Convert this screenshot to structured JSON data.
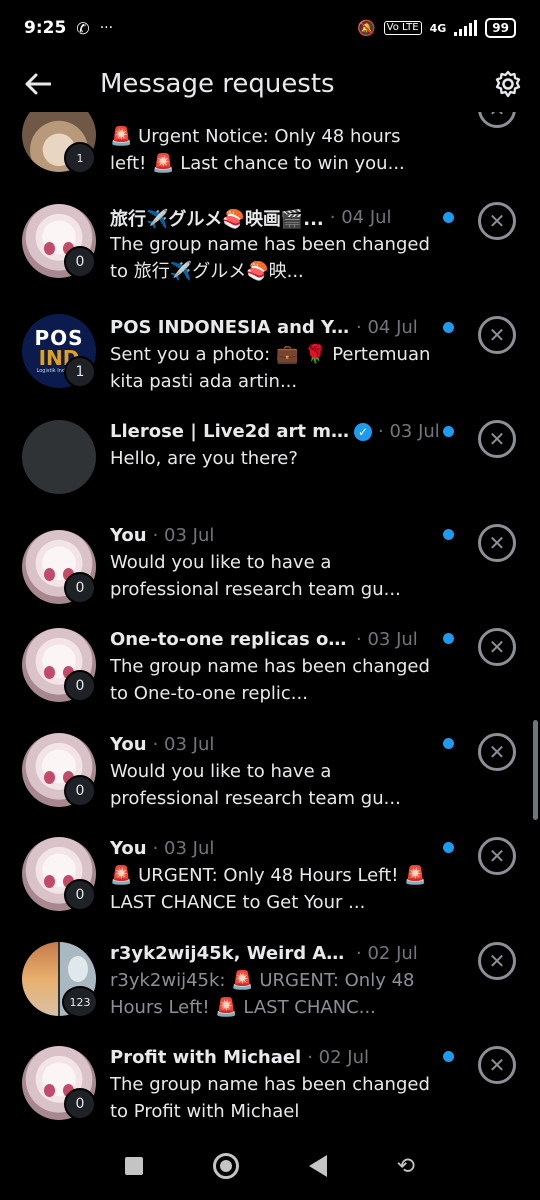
{
  "status": {
    "time": "9:25",
    "whatsapp_icon": "whatsapp-icon",
    "more": "···",
    "network": "4G",
    "volte": "Vo LTE",
    "battery": "99"
  },
  "header": {
    "title": "Message requests"
  },
  "rows": [
    {
      "name": "",
      "date": "",
      "preview": "🚨 Urgent Notice: Only 48 hours left! 🚨 Last chance to win you...",
      "badge": "1",
      "avatar": "hat",
      "unread": false
    },
    {
      "name": "旅行✈️グルメ🍣映画🎬...",
      "date": "· 04 Jul",
      "preview": "The group name has been changed to 旅行✈️グルメ🍣映...",
      "badge": "0",
      "avatar": "anime",
      "unread": true
    },
    {
      "name": "POS INDONESIA and Y...",
      "date": "· 04 Jul",
      "preview": "Sent you a photo: 💼 🌹 Pertemuan kita pasti ada artin...",
      "badge": "1",
      "avatar": "pos",
      "unread": true
    },
    {
      "name": "Llerose | Live2d art m...",
      "date": "· 03 Jul",
      "preview": "Hello, are you there?",
      "badge": "",
      "avatar": "gray",
      "unread": true,
      "verified": true
    },
    {
      "name": "You",
      "date": "· 03 Jul",
      "preview": "Would you like to have a professional research team gu...",
      "badge": "0",
      "avatar": "anime",
      "unread": true
    },
    {
      "name": "One-to-one replicas of...",
      "date": "· 03 Jul",
      "preview": "The group name has been changed to One-to-one replic...",
      "badge": "0",
      "avatar": "anime",
      "unread": true
    },
    {
      "name": "You",
      "date": "· 03 Jul",
      "preview": "Would you like to have a professional research team gu...",
      "badge": "0",
      "avatar": "anime",
      "unread": true
    },
    {
      "name": "You",
      "date": "· 03 Jul",
      "preview": "🚨 URGENT: Only 48 Hours Left! 🚨 LAST CHANCE to Get Your ...",
      "badge": "0",
      "avatar": "anime",
      "unread": true
    },
    {
      "name": "r3yk2wij45k, Weird Al P...",
      "date": "· 02 Jul",
      "preview": "r3yk2wij45k: 🚨 URGENT: Only 48 Hours Left! 🚨 LAST CHANC...",
      "badge": "123",
      "avatar": "group",
      "unread": false,
      "dim": true
    },
    {
      "name": "Profit with Michael",
      "date": "· 02 Jul",
      "preview": "The group name has been changed to Profit with Michael",
      "badge": "0",
      "avatar": "anime",
      "unread": true
    }
  ],
  "pos_logo": {
    "line1": "POS",
    "line2": "IND",
    "line3": "Logistik Indonesia"
  },
  "icons": {
    "back": "arrow-left-icon",
    "settings": "gear-icon",
    "dismiss": "close-circle-icon",
    "verified": "verified-badge-icon"
  },
  "colors": {
    "accent": "#1d9bf0",
    "background": "#000000",
    "muted": "#71767b"
  }
}
